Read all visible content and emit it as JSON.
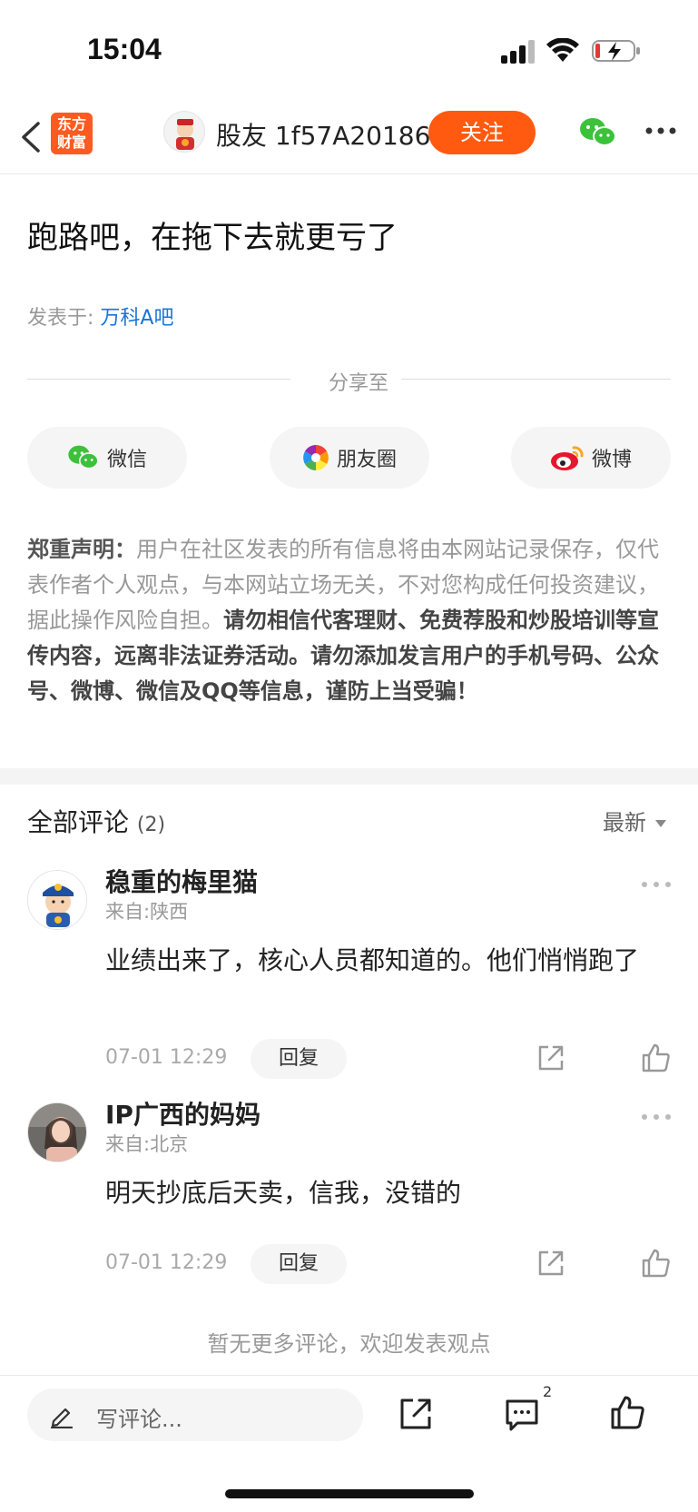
{
  "status": {
    "time": "15:04"
  },
  "nav": {
    "logo_line1": "东方",
    "logo_line2": "财富",
    "username": "股友 1f57A20186",
    "follow_label": "关注"
  },
  "post": {
    "title": "跑路吧，在拖下去就更亏了",
    "posted_prefix": "发表于: ",
    "bar_name": "万科A吧"
  },
  "share": {
    "divider_label": "分享至",
    "wechat": "微信",
    "moments": "朋友圈",
    "weibo": "微博"
  },
  "disclaimer": {
    "label": "郑重声明：",
    "normal": "用户在社区发表的所有信息将由本网站记录保存，仅代表作者个人观点，与本网站立场无关，不对您构成任何投资建议，据此操作风险自担。",
    "bold": "请勿相信代客理财、免费荐股和炒股培训等宣传内容，远离非法证券活动。请勿添加发言用户的手机号码、公众号、微博、微信及QQ等信息，谨防上当受骗！"
  },
  "comments_section": {
    "title": "全部评论",
    "count": "(2)",
    "sort_label": "最新",
    "items": [
      {
        "name": "稳重的梅里猫",
        "location": "来自:陕西",
        "text": "业绩出来了，核心人员都知道的。他们悄悄跑了",
        "time": "07-01 12:29",
        "reply_label": "回复"
      },
      {
        "name": "IP广西的妈妈",
        "location": "来自:北京",
        "text": "明天抄底后天卖，信我，没错的",
        "time": "07-01 12:29",
        "reply_label": "回复"
      }
    ],
    "no_more": "暂无更多评论，欢迎发表观点"
  },
  "bottom": {
    "placeholder": "写评论...",
    "comment_count": "2"
  },
  "colors": {
    "accent": "#ff5a10",
    "link": "#1a73d9",
    "wechat_green": "#3cc13b"
  }
}
